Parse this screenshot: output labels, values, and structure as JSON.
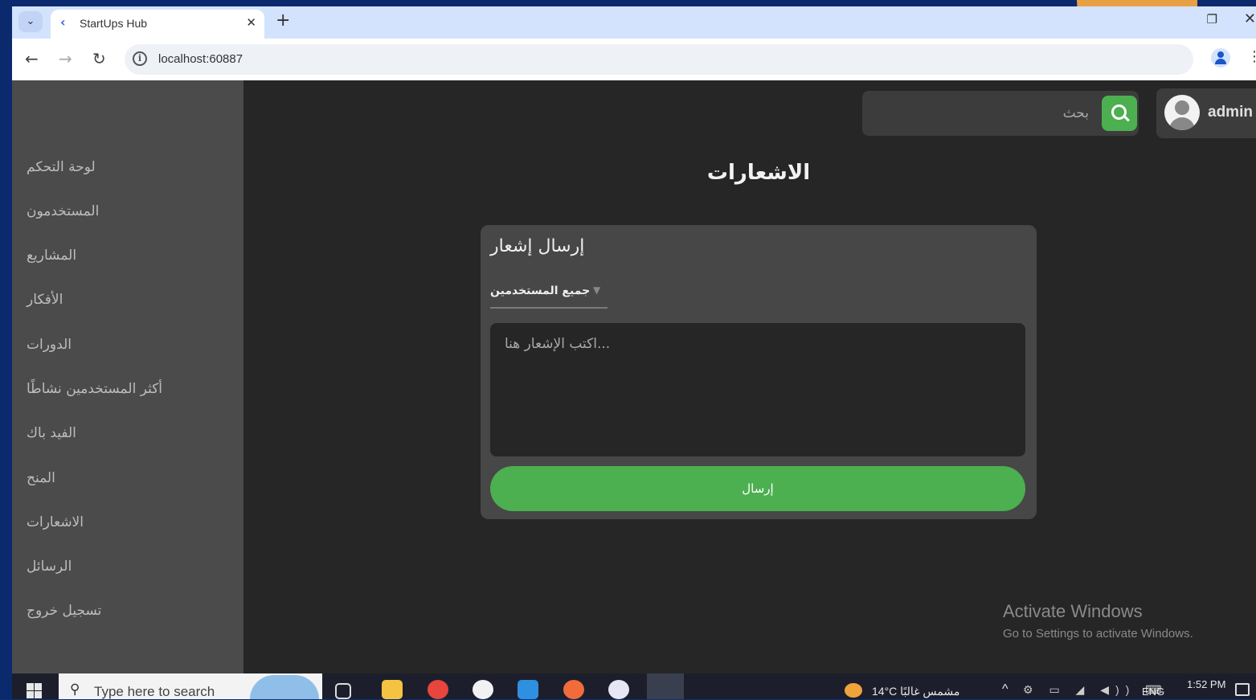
{
  "browser": {
    "tab_title": "StartUps Hub",
    "url": "localhost:60887"
  },
  "header": {
    "search_placeholder": "بحث",
    "username": "admin"
  },
  "sidebar": {
    "items": [
      {
        "label": "لوحة التحكم"
      },
      {
        "label": "المستخدمون"
      },
      {
        "label": "المشاريع"
      },
      {
        "label": "الأفكار"
      },
      {
        "label": "الدورات"
      },
      {
        "label": "أكثر المستخدمين نشاطًا"
      },
      {
        "label": "الفيد باك"
      },
      {
        "label": "المنح"
      },
      {
        "label": "الاشعارات"
      },
      {
        "label": "الرسائل"
      },
      {
        "label": "تسجيل خروج"
      }
    ]
  },
  "main": {
    "page_title": "الاشعارات",
    "card_title": "إرسال إشعار",
    "recipient_value": "جميع المستخدمين",
    "message_placeholder": "...اكتب الإشعار هنا",
    "send_label": "إرسال"
  },
  "watermark": {
    "title": "Activate Windows",
    "subtitle": "Go to Settings to activate Windows."
  },
  "taskbar": {
    "search_placeholder": "Type here to search",
    "weather": "14°C  مشمس غالبًا",
    "language": "ENG",
    "time": "1:52 PM"
  },
  "colors": {
    "accent_green": "#4caf50",
    "sidebar_bg": "#4b4b4b",
    "main_bg": "#262626"
  }
}
